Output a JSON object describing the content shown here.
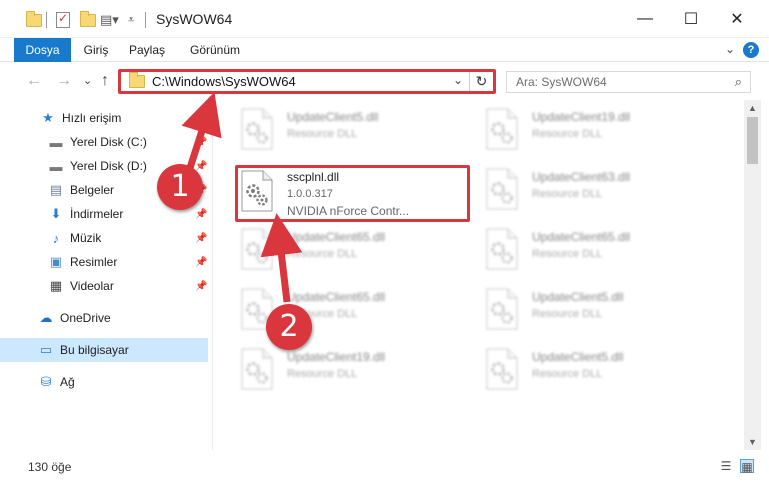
{
  "window": {
    "title": "SysWOW64",
    "minimize_glyph": "—",
    "maximize_glyph": "☐",
    "close_glyph": "✕"
  },
  "ribbon": {
    "tabs": [
      "Dosya",
      "Giriş",
      "Paylaş",
      "Görünüm"
    ],
    "help_glyph": "?",
    "collapse_glyph": "⌄"
  },
  "nav": {
    "back_glyph": "←",
    "forward_glyph": "→",
    "recent_glyph": "⌄",
    "up_glyph": "↑",
    "address": "C:\\Windows\\SysWOW64",
    "address_dropdown_glyph": "⌄",
    "refresh_glyph": "↻",
    "search_placeholder": "Ara: SysWOW64",
    "search_glyph": "⌕"
  },
  "sidebar": {
    "items": [
      {
        "label": "Hızlı erişim",
        "icon": "star-icon",
        "glyph": "★",
        "color": "#2a7fd4",
        "pinned": false
      },
      {
        "label": "Yerel Disk (C:)",
        "icon": "drive-icon",
        "glyph": "▬",
        "color": "#7a7a7a",
        "pinned": true
      },
      {
        "label": "Yerel Disk (D:)",
        "icon": "drive-icon",
        "glyph": "▬",
        "color": "#7a7a7a",
        "pinned": true
      },
      {
        "label": "Belgeler",
        "icon": "documents-icon",
        "glyph": "▤",
        "color": "#6b7f99",
        "pinned": true
      },
      {
        "label": "İndirmeler",
        "icon": "download-icon",
        "glyph": "⬇",
        "color": "#2a7fd4",
        "pinned": true
      },
      {
        "label": "Müzik",
        "icon": "music-icon",
        "glyph": "♪",
        "color": "#2a7fd4",
        "pinned": true
      },
      {
        "label": "Resimler",
        "icon": "pictures-icon",
        "glyph": "▣",
        "color": "#4a8ac9",
        "pinned": true
      },
      {
        "label": "Videolar",
        "icon": "video-icon",
        "glyph": "▦",
        "color": "#444444",
        "pinned": true
      },
      {
        "label": "OneDrive",
        "icon": "cloud-icon",
        "glyph": "☁",
        "color": "#1a73c9",
        "pinned": false
      },
      {
        "label": "Bu bilgisayar",
        "icon": "computer-icon",
        "glyph": "▭",
        "color": "#2a7fd4",
        "pinned": false
      },
      {
        "label": "Ağ",
        "icon": "network-icon",
        "glyph": "⛁",
        "color": "#2a7fd4",
        "pinned": false
      }
    ],
    "pin_glyph": "📌",
    "selected_index": 9
  },
  "files": {
    "highlighted": {
      "name": "sscplnl.dll",
      "version": "1.0.0.317",
      "description": "NVIDIA nForce Contr..."
    },
    "blurred": [
      {
        "name": "UpdateClient5.dll",
        "type": "Resource DLL"
      },
      {
        "name": "UpdateClient19.dll",
        "type": "Resource DLL"
      },
      {
        "name": "UpdateClient63.dll",
        "type": "Resource DLL"
      },
      {
        "name": "UpdateClient65.dll",
        "type": "Resource DLL"
      },
      {
        "name": "UpdateClient65.dll",
        "type": "Resource DLL"
      },
      {
        "name": "UpdateClient65.dll",
        "type": "Resource DLL"
      },
      {
        "name": "UpdateClient5.dll",
        "type": "Resource DLL"
      },
      {
        "name": "UpdateClient19.dll",
        "type": "Resource DLL"
      },
      {
        "name": "UpdateClient5.dll",
        "type": "Resource DLL"
      }
    ]
  },
  "status": {
    "item_count": "130 öğe",
    "details_view_glyph": "☰",
    "tiles_view_glyph": "▦"
  },
  "annotations": {
    "badge1": "1",
    "badge2": "2",
    "accent_color": "#d9363e"
  }
}
